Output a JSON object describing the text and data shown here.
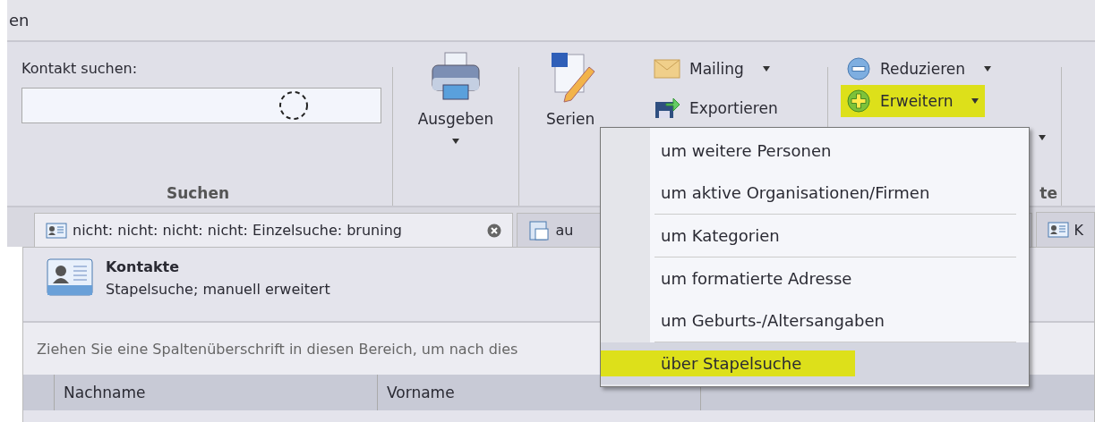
{
  "window": {
    "title": "en"
  },
  "ribbon": {
    "search_group": {
      "label": "Kontakt suchen:",
      "caption": "Suchen"
    },
    "print_button": {
      "label": "Ausgeben"
    },
    "letter_button": {
      "label": "Serien"
    },
    "small_buttons": [
      {
        "label": "Mailing",
        "kind": "mail",
        "dropdown": true
      },
      {
        "label": "Exportieren",
        "kind": "export",
        "dropdown": false
      }
    ],
    "filter_buttons": [
      {
        "label": "Reduzieren",
        "kind": "minus",
        "highlighted": false
      },
      {
        "label": "Erweitern",
        "kind": "plus",
        "highlighted": true
      }
    ],
    "filter_group_caption": "te"
  },
  "tabs": [
    {
      "label": "nicht: nicht: nicht: nicht: Einzelsuche: bruning",
      "selected": true,
      "closable": true
    },
    {
      "label": "au",
      "selected": false,
      "closable": false
    },
    {
      "label": "K",
      "selected": false,
      "closable": false
    }
  ],
  "panel": {
    "title": "Kontakte",
    "subtitle": "Stapelsuche; manuell erweitert",
    "group_hint": "Ziehen Sie eine Spaltenüberschrift in diesen Bereich, um nach dies",
    "columns": [
      "Nachname",
      "Vorname"
    ]
  },
  "menu": {
    "items": [
      {
        "label": "um weitere Personen",
        "selected": false,
        "highlighted": false,
        "separator_after": false
      },
      {
        "label": "um aktive Organisationen/Firmen",
        "selected": false,
        "highlighted": false,
        "separator_after": true
      },
      {
        "label": "um Kategorien",
        "selected": false,
        "highlighted": false,
        "separator_after": true
      },
      {
        "label": "um formatierte Adresse",
        "selected": false,
        "highlighted": false,
        "separator_after": false
      },
      {
        "label": "um Geburts-/Altersangaben",
        "selected": false,
        "highlighted": false,
        "separator_after": true
      },
      {
        "label": "über Stapelsuche",
        "selected": true,
        "highlighted": true,
        "separator_after": false
      }
    ]
  }
}
